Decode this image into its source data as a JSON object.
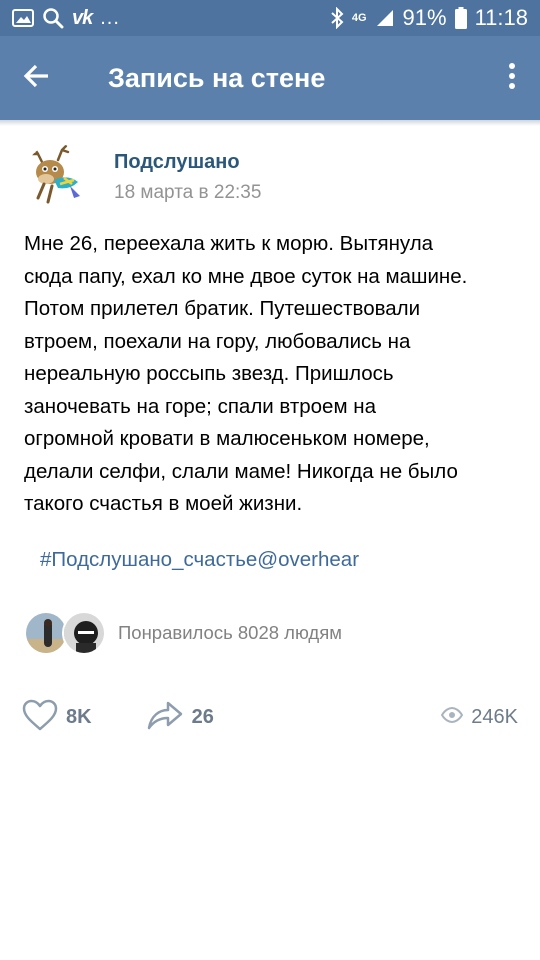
{
  "status_bar": {
    "carrier_icons": [
      "image-icon",
      "search-icon",
      "vk-icon"
    ],
    "vk_text": "vk",
    "more": "...",
    "network": "4G",
    "battery": "91%",
    "time": "11:18"
  },
  "app_bar": {
    "title": "Запись на стене"
  },
  "post": {
    "author": "Подслушано",
    "date": "18 марта в 22:35",
    "text": "Мне 26, переехала жить к морю. Вытянула\nсюда папу, ехал ко мне двое суток на машине.\nПотом прилетел братик. Путешествовали\nвтроем, поехали на гору, любовались на\nнереальную россыпь звезд. Пришлось\nзаночевать на горе; спали втроем на\nогромной кровати в малюсеньком номере,\nделали селфи, слали маме! Никогда не было\nтакого счастья в моей жизни.",
    "hashtag": "#Подслушано_счастье@overhear",
    "likes_text": "Понравилось 8028 людям"
  },
  "actions": {
    "likes": "8K",
    "shares": "26",
    "views": "246K"
  },
  "colors": {
    "status_bar": "#4e739e",
    "app_bar": "#5b80ac",
    "link": "#2b587a",
    "hashtag": "#3e6a9b",
    "meta": "#939393",
    "action": "#6d7b8a"
  }
}
